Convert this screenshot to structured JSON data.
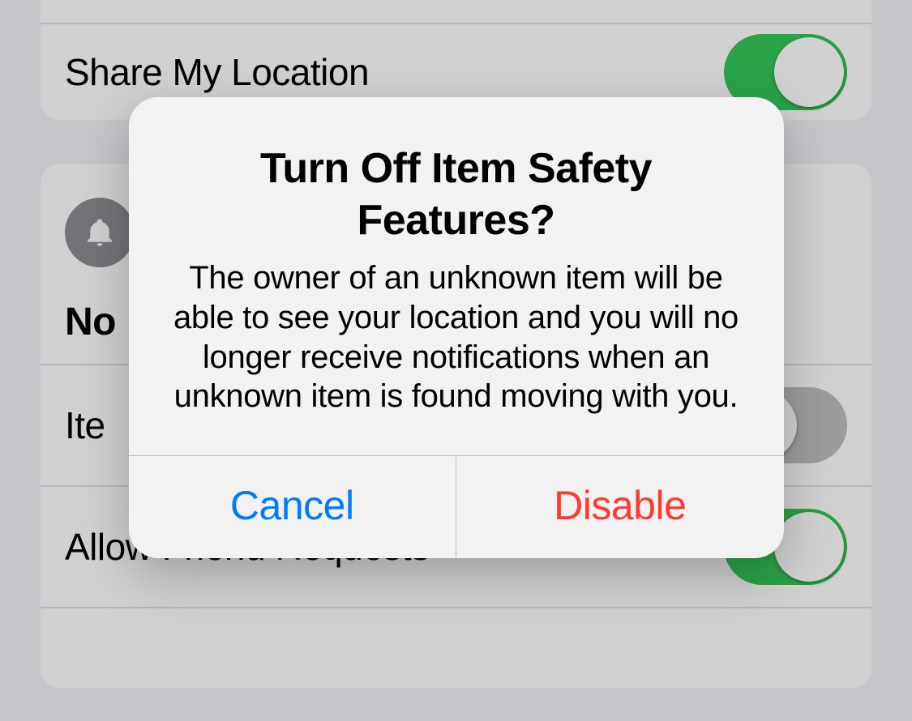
{
  "settings": {
    "shareLocation": {
      "label": "Share My Location",
      "on": true
    },
    "section2": {
      "heading": "No",
      "icon": "bell-icon",
      "itemSafety": {
        "label": "Ite",
        "on": false
      },
      "allowFriendRequests": {
        "label": "Allow Friend Requests",
        "on": true
      }
    }
  },
  "alert": {
    "title": "Turn Off Item Safety Features?",
    "message": "The owner of an unknown item will be able to see your location and you will no longer receive notifications when an unknown item is found moving with you.",
    "cancel": "Cancel",
    "disable": "Disable"
  }
}
